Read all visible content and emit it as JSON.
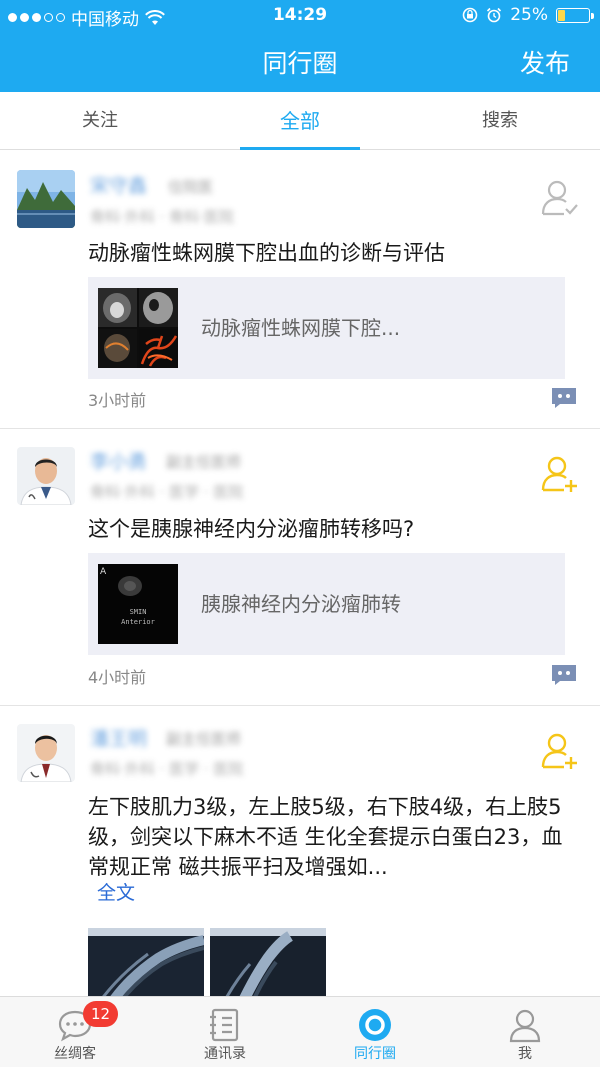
{
  "status_bar": {
    "carrier": "中国移动",
    "time": "14:29",
    "battery_percent": "25%",
    "battery_level": 0.25
  },
  "nav": {
    "title": "同行圈",
    "action": "发布"
  },
  "tabs": [
    {
      "label": "关注",
      "active": false
    },
    {
      "label": "全部",
      "active": true
    },
    {
      "label": "搜索",
      "active": false
    }
  ],
  "posts": [
    {
      "author": "宋守鑫",
      "role": "住院医",
      "org": "骨科·外科 · 骨科·医院",
      "title": "动脉瘤性蛛网膜下腔出血的诊断与评估",
      "card_text": "动脉瘤性蛛网膜下腔...",
      "time": "3小时前",
      "follow_icon": "user-followed-icon"
    },
    {
      "author": "李小勇",
      "role": "副主任医师",
      "org": "骨科·外科 · 医学 · 医院",
      "title": "这个是胰腺神经内分泌瘤肺转移吗?",
      "card_text": "胰腺神经内分泌瘤肺转",
      "card_thumb_letter": "A",
      "card_thumb_caption_1": "SMIN",
      "card_thumb_caption_2": "Anterior",
      "time": "4小时前",
      "follow_icon": "user-add-icon"
    },
    {
      "author": "潘王明",
      "role": "副主任医师",
      "org": "骨科·外科 · 医学 · 医院",
      "body": "左下肢肌力3级，左上肢5级，右下肢4级，右上肢5级，剑突以下麻木不适 生化全套提示白蛋白23，血常规正常 磁共振平扫及增强如...",
      "full_text_link": "全文",
      "follow_icon": "user-add-icon"
    }
  ],
  "bottom_tabs": [
    {
      "label": "丝绸客",
      "badge": "12",
      "icon": "chat-icon"
    },
    {
      "label": "通讯录",
      "icon": "contacts-icon"
    },
    {
      "label": "同行圈",
      "icon": "circle-icon",
      "active": true
    },
    {
      "label": "我",
      "icon": "person-icon"
    }
  ],
  "colors": {
    "brand": "#1eaaf1",
    "follow_accent": "#f5c518",
    "badge": "#f23b32"
  }
}
